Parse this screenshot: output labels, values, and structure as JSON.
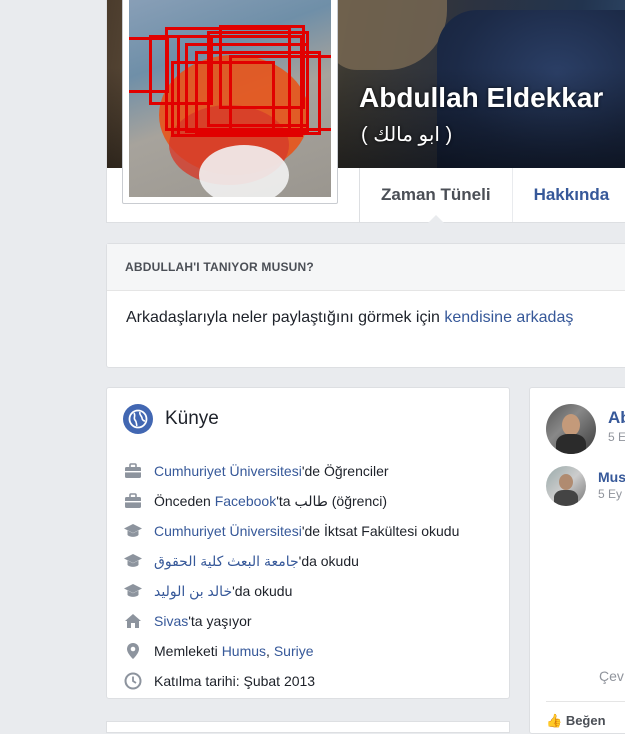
{
  "profile": {
    "name": "Abdullah Eldekkar",
    "alt_name": "( ابو مالك )"
  },
  "tabs": [
    {
      "label": "Zaman Tüneli",
      "active": true
    },
    {
      "label": "Hakkında",
      "active": false
    }
  ],
  "know_card": {
    "heading": "ABDULLAH'I TANIYOR MUSUN?",
    "text": "Arkadaşlarıyla neler paylaştığını görmek için ",
    "link": "kendisine arkadaş"
  },
  "intro": {
    "title": "Künye",
    "items": [
      {
        "icon": "briefcase-icon",
        "parts": [
          {
            "t": "Cumhuriyet Üniversitesi",
            "link": true
          },
          {
            "t": "'de Öğrenciler",
            "link": false
          }
        ]
      },
      {
        "icon": "briefcase-icon",
        "parts": [
          {
            "t": "Önceden ",
            "link": false
          },
          {
            "t": "Facebook",
            "link": true
          },
          {
            "t": "'ta طالب (öğrenci)",
            "link": false
          }
        ]
      },
      {
        "icon": "graduation-cap-icon",
        "parts": [
          {
            "t": "Cumhuriyet Üniversitesi",
            "link": true
          },
          {
            "t": "'de İktsat Fakültesi okudu",
            "link": false
          }
        ]
      },
      {
        "icon": "graduation-cap-icon",
        "parts": [
          {
            "t": "جامعة البعث كلية الحقوق",
            "link": true
          },
          {
            "t": "'da okudu",
            "link": false
          }
        ]
      },
      {
        "icon": "graduation-cap-icon",
        "parts": [
          {
            "t": "خالد بن الوليد",
            "link": true
          },
          {
            "t": "'da okudu",
            "link": false
          }
        ]
      },
      {
        "icon": "home-icon",
        "parts": [
          {
            "t": "Sivas",
            "link": true
          },
          {
            "t": "'ta yaşıyor",
            "link": false
          }
        ]
      },
      {
        "icon": "location-pin-icon",
        "parts": [
          {
            "t": "Memleketi ",
            "link": false
          },
          {
            "t": "Humus",
            "link": true
          },
          {
            "t": ", ",
            "link": false
          },
          {
            "t": "Suriye",
            "link": true
          }
        ]
      },
      {
        "icon": "clock-icon",
        "parts": [
          {
            "t": "Katılma tarihi: Şubat 2013",
            "link": false
          }
        ]
      }
    ]
  },
  "posts": [
    {
      "name": "Ab",
      "time": "5 E"
    },
    {
      "name": "Mus",
      "time": "5 Ey"
    }
  ],
  "right_more": "Çev",
  "like_label": "Beğen",
  "colors": {
    "link": "#365899",
    "background": "#e9ebee",
    "accent": "#4267b2",
    "highlight_boxes": "#e10000"
  }
}
